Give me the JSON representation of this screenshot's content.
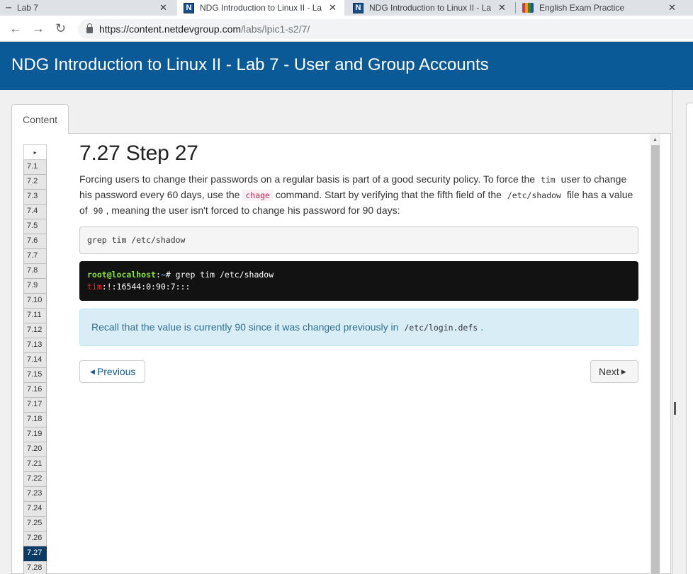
{
  "browser": {
    "tabs": [
      {
        "label": "Lab 7",
        "icon": "lab-favicon",
        "active": false
      },
      {
        "label": "NDG Introduction to Linux II - La",
        "icon": "ndg-favicon",
        "active": true
      },
      {
        "label": "NDG Introduction to Linux II - La",
        "icon": "ndg-favicon",
        "active": false
      },
      {
        "label": "English Exam Practice",
        "icon": "google-favicon",
        "active": false
      }
    ],
    "close_glyph": "✕",
    "url_host": "https://content.netdevgroup.com",
    "url_path": "/labs/lpic1-s2/7/",
    "nav": {
      "back": "←",
      "forward": "→",
      "reload": "↻"
    }
  },
  "header": {
    "title": "NDG Introduction to Linux II - Lab 7 - User and Group Accounts"
  },
  "content_tab": {
    "label": "Content"
  },
  "stepnav": {
    "toggle": "▸",
    "steps": [
      "7.1",
      "7.2",
      "7.3",
      "7.4",
      "7.5",
      "7.6",
      "7.7",
      "7.8",
      "7.9",
      "7.10",
      "7.11",
      "7.12",
      "7.13",
      "7.14",
      "7.15",
      "7.16",
      "7.17",
      "7.18",
      "7.19",
      "7.20",
      "7.21",
      "7.22",
      "7.23",
      "7.24",
      "7.25",
      "7.26",
      "7.27",
      "7.28"
    ],
    "active": "7.27"
  },
  "main": {
    "heading": "7.27 Step 27",
    "p1": "Forcing users to change their passwords on a regular basis is part of a good security policy. To force the",
    "code_tim": "tim",
    "p2": "user to change his password every 60 days, use the",
    "code_chage": "chage",
    "p3": "command. Start by verifying that the fifth field of the",
    "code_shadow": "/etc/shadow",
    "p4": "file has a value of",
    "code_90": "90",
    "p5": ", meaning the user isn't forced to change his password for 90 days:",
    "command": "grep tim /etc/shadow",
    "terminal": {
      "prompt_user": "root@localhost",
      "prompt_sep": ":",
      "prompt_path": "~",
      "prompt_hash": "#",
      "cmd": " grep tim /etc/shadow",
      "out_user": "tim",
      "out_rest": ":!:16544:0:90:7:::"
    },
    "info_text": "Recall that the value is currently 90 since it was changed previously in",
    "info_code": "/etc/login.defs",
    "info_end": ".",
    "prev_label": "Previous",
    "next_label": "Next"
  },
  "colors": {
    "banner": "#0b5a98",
    "active_step": "#0c3c66",
    "info_bg": "#d9edf7"
  }
}
